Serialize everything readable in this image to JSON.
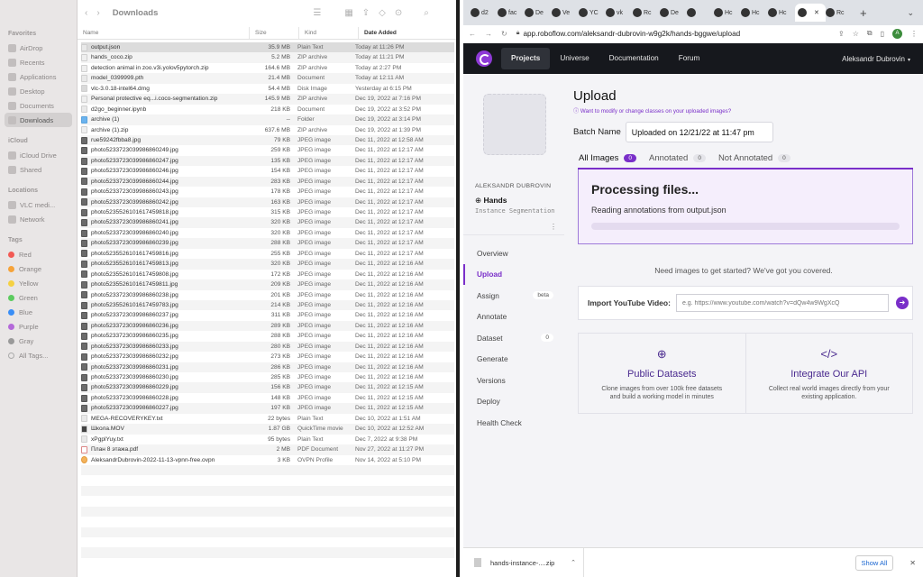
{
  "finder": {
    "title": "Downloads",
    "sidebar": {
      "favorites_header": "Favorites",
      "favorites": [
        "AirDrop",
        "Recents",
        "Applications",
        "Desktop",
        "Documents",
        "Downloads"
      ],
      "icloud_header": "iCloud",
      "icloud": [
        "iCloud Drive",
        "Shared"
      ],
      "locations_header": "Locations",
      "locations": [
        "VLC medi...",
        "Network"
      ],
      "tags_header": "Tags",
      "tags": [
        {
          "label": "Red",
          "color": "#f25a54"
        },
        {
          "label": "Orange",
          "color": "#f6a33a"
        },
        {
          "label": "Yellow",
          "color": "#f5d142"
        },
        {
          "label": "Green",
          "color": "#5ccb5f"
        },
        {
          "label": "Blue",
          "color": "#3a8ef6"
        },
        {
          "label": "Purple",
          "color": "#b469d9"
        },
        {
          "label": "Gray",
          "color": "#9a9a9a"
        },
        {
          "label": "All Tags...",
          "color": "#e9e6e6"
        }
      ]
    },
    "columns": {
      "name": "Name",
      "size": "Size",
      "kind": "Kind",
      "date": "Date Added"
    },
    "files": [
      {
        "name": "output.json",
        "size": "35.9 MB",
        "kind": "Plain Text",
        "date": "Today at 11:26 PM",
        "icon": "doc"
      },
      {
        "name": "hands_coco.zip",
        "size": "5.2 MB",
        "kind": "ZIP archive",
        "date": "Today at 11:21 PM",
        "icon": "zip"
      },
      {
        "name": "detection animal in zoo.v3i.yolov5pytorch.zip",
        "size": "164.6 MB",
        "kind": "ZIP archive",
        "date": "Today at 2:27 PM",
        "icon": "zip"
      },
      {
        "name": "model_0399999.pth",
        "size": "21.4 MB",
        "kind": "Document",
        "date": "Today at 12:11 AM",
        "icon": "doc"
      },
      {
        "name": "vlc-3.0.18-intel64.dmg",
        "size": "54.4 MB",
        "kind": "Disk Image",
        "date": "Yesterday at 6:15 PM",
        "icon": "dmg"
      },
      {
        "name": "Personal protective eq...i.coco-segmentation.zip",
        "size": "145.9 MB",
        "kind": "ZIP archive",
        "date": "Dec 19, 2022 at 7:16 PM",
        "icon": "zip"
      },
      {
        "name": "d2go_beginner.ipynb",
        "size": "218 KB",
        "kind": "Document",
        "date": "Dec 19, 2022 at 3:52 PM",
        "icon": "doc"
      },
      {
        "name": "archive (1)",
        "size": "--",
        "kind": "Folder",
        "date": "Dec 19, 2022 at 3:14 PM",
        "icon": "folder"
      },
      {
        "name": "archive (1).zip",
        "size": "637.6 MB",
        "kind": "ZIP archive",
        "date": "Dec 19, 2022 at 1:39 PM",
        "icon": "zip"
      },
      {
        "name": "rue59242fbba8.jpg",
        "size": "79 KB",
        "kind": "JPEG image",
        "date": "Dec 11, 2022 at 12:58 AM",
        "icon": "jpg"
      },
      {
        "name": "photo5233723039986860249.jpg",
        "size": "259 KB",
        "kind": "JPEG image",
        "date": "Dec 11, 2022 at 12:17 AM",
        "icon": "jpg"
      },
      {
        "name": "photo5233723039986860247.jpg",
        "size": "135 KB",
        "kind": "JPEG image",
        "date": "Dec 11, 2022 at 12:17 AM",
        "icon": "jpg"
      },
      {
        "name": "photo5233723039986860246.jpg",
        "size": "154 KB",
        "kind": "JPEG image",
        "date": "Dec 11, 2022 at 12:17 AM",
        "icon": "jpg"
      },
      {
        "name": "photo5233723039986860244.jpg",
        "size": "283 KB",
        "kind": "JPEG image",
        "date": "Dec 11, 2022 at 12:17 AM",
        "icon": "jpg"
      },
      {
        "name": "photo5233723039986860243.jpg",
        "size": "178 KB",
        "kind": "JPEG image",
        "date": "Dec 11, 2022 at 12:17 AM",
        "icon": "jpg"
      },
      {
        "name": "photo5233723039986860242.jpg",
        "size": "163 KB",
        "kind": "JPEG image",
        "date": "Dec 11, 2022 at 12:17 AM",
        "icon": "jpg"
      },
      {
        "name": "photo5235526101617459818.jpg",
        "size": "315 KB",
        "kind": "JPEG image",
        "date": "Dec 11, 2022 at 12:17 AM",
        "icon": "jpg"
      },
      {
        "name": "photo5233723039986860241.jpg",
        "size": "320 KB",
        "kind": "JPEG image",
        "date": "Dec 11, 2022 at 12:17 AM",
        "icon": "jpg"
      },
      {
        "name": "photo5233723039986860240.jpg",
        "size": "320 KB",
        "kind": "JPEG image",
        "date": "Dec 11, 2022 at 12:17 AM",
        "icon": "jpg"
      },
      {
        "name": "photo5233723039986860239.jpg",
        "size": "288 KB",
        "kind": "JPEG image",
        "date": "Dec 11, 2022 at 12:17 AM",
        "icon": "jpg"
      },
      {
        "name": "photo5235526101617459816.jpg",
        "size": "255 KB",
        "kind": "JPEG image",
        "date": "Dec 11, 2022 at 12:17 AM",
        "icon": "jpg"
      },
      {
        "name": "photo5235526101617459813.jpg",
        "size": "320 KB",
        "kind": "JPEG image",
        "date": "Dec 11, 2022 at 12:16 AM",
        "icon": "jpg"
      },
      {
        "name": "photo5235526101617459808.jpg",
        "size": "172 KB",
        "kind": "JPEG image",
        "date": "Dec 11, 2022 at 12:16 AM",
        "icon": "jpg"
      },
      {
        "name": "photo5235526101617459811.jpg",
        "size": "209 KB",
        "kind": "JPEG image",
        "date": "Dec 11, 2022 at 12:16 AM",
        "icon": "jpg"
      },
      {
        "name": "photo5233723039986860238.jpg",
        "size": "201 KB",
        "kind": "JPEG image",
        "date": "Dec 11, 2022 at 12:16 AM",
        "icon": "jpg"
      },
      {
        "name": "photo5235526101617459783.jpg",
        "size": "214 KB",
        "kind": "JPEG image",
        "date": "Dec 11, 2022 at 12:16 AM",
        "icon": "jpg"
      },
      {
        "name": "photo5233723039986860237.jpg",
        "size": "311 KB",
        "kind": "JPEG image",
        "date": "Dec 11, 2022 at 12:16 AM",
        "icon": "jpg"
      },
      {
        "name": "photo5233723039986860236.jpg",
        "size": "289 KB",
        "kind": "JPEG image",
        "date": "Dec 11, 2022 at 12:16 AM",
        "icon": "jpg"
      },
      {
        "name": "photo5233723039986860235.jpg",
        "size": "288 KB",
        "kind": "JPEG image",
        "date": "Dec 11, 2022 at 12:16 AM",
        "icon": "jpg"
      },
      {
        "name": "photo5233723039986860233.jpg",
        "size": "280 KB",
        "kind": "JPEG image",
        "date": "Dec 11, 2022 at 12:16 AM",
        "icon": "jpg"
      },
      {
        "name": "photo5233723039986860232.jpg",
        "size": "273 KB",
        "kind": "JPEG image",
        "date": "Dec 11, 2022 at 12:16 AM",
        "icon": "jpg"
      },
      {
        "name": "photo5233723039986860231.jpg",
        "size": "286 KB",
        "kind": "JPEG image",
        "date": "Dec 11, 2022 at 12:16 AM",
        "icon": "jpg"
      },
      {
        "name": "photo5233723039986860230.jpg",
        "size": "285 KB",
        "kind": "JPEG image",
        "date": "Dec 11, 2022 at 12:16 AM",
        "icon": "jpg"
      },
      {
        "name": "photo5233723039986860229.jpg",
        "size": "156 KB",
        "kind": "JPEG image",
        "date": "Dec 11, 2022 at 12:15 AM",
        "icon": "jpg"
      },
      {
        "name": "photo5233723039986860228.jpg",
        "size": "148 KB",
        "kind": "JPEG image",
        "date": "Dec 11, 2022 at 12:15 AM",
        "icon": "jpg"
      },
      {
        "name": "photo5233723039986860227.jpg",
        "size": "197 KB",
        "kind": "JPEG image",
        "date": "Dec 11, 2022 at 12:15 AM",
        "icon": "jpg"
      },
      {
        "name": "MEGA-RECOVERYKEY.txt",
        "size": "22 bytes",
        "kind": "Plain Text",
        "date": "Dec 10, 2022 at 1:51 AM",
        "icon": "doc"
      },
      {
        "name": "Школа.MOV",
        "size": "1.87 GB",
        "kind": "QuickTime movie",
        "date": "Dec 10, 2022 at 12:52 AM",
        "icon": "mov"
      },
      {
        "name": "xPgplYuy.txt",
        "size": "95 bytes",
        "kind": "Plain Text",
        "date": "Dec 7, 2022 at 9:38 PM",
        "icon": "doc"
      },
      {
        "name": "План 8 этажа.pdf",
        "size": "2 MB",
        "kind": "PDF Document",
        "date": "Nov 27, 2022 at 11:27 PM",
        "icon": "pdf"
      },
      {
        "name": "AleksandrDubrovin-2022-11-13-vpnn-free.ovpn",
        "size": "3 KB",
        "kind": "OVPN Profile",
        "date": "Nov 14, 2022 at 5:10 PM",
        "icon": "ovpn"
      }
    ]
  },
  "browser": {
    "tabs": [
      "d2",
      "fac",
      "De",
      "Ve",
      "YC",
      "vk",
      "Rc",
      "De",
      "",
      "Hc",
      "Hc",
      "Hc",
      "",
      "Rc"
    ],
    "url": "app.roboflow.com/aleksandr-dubrovin-w9g2k/hands-bggwe/upload",
    "avatar_letter": "A",
    "nav": {
      "items": [
        "Projects",
        "Universe",
        "Documentation",
        "Forum"
      ],
      "user": "Aleksandr Dubrovin"
    },
    "project": {
      "owner": "ALEKSANDR DUBROVIN",
      "name": "Hands",
      "type": "Instance Segmentation",
      "menu": [
        {
          "label": "Overview",
          "badge": ""
        },
        {
          "label": "Upload",
          "badge": ""
        },
        {
          "label": "Assign",
          "badge": "beta"
        },
        {
          "label": "Annotate",
          "badge": ""
        },
        {
          "label": "Dataset",
          "badge": "0"
        },
        {
          "label": "Generate",
          "badge": ""
        },
        {
          "label": "Versions",
          "badge": ""
        },
        {
          "label": "Deploy",
          "badge": ""
        },
        {
          "label": "Health Check",
          "badge": ""
        }
      ]
    },
    "upload": {
      "title": "Upload",
      "help_link": "Want to modify or change classes on your uploaded images?",
      "batch_label": "Batch Name",
      "batch_value": "Uploaded on 12/21/22 at 11:47 pm",
      "tabs": [
        {
          "label": "All Images",
          "count": "0"
        },
        {
          "label": "Annotated",
          "count": "0"
        },
        {
          "label": "Not Annotated",
          "count": "0"
        }
      ],
      "processing_title": "Processing files...",
      "processing_sub": "Reading annotations from output.json",
      "need_images": "Need images to get started? We've got you covered.",
      "youtube_label": "Import YouTube Video:",
      "youtube_placeholder": "e.g. https://www.youtube.com/watch?v=dQw4w9WgXcQ",
      "cards": [
        {
          "title": "Public Datasets",
          "desc": "Clone images from over 100k free datasets and build a working model in minutes",
          "icon": "globe-icon"
        },
        {
          "title": "Integrate Our API",
          "desc": "Collect real world images directly from your existing application.",
          "icon": "code-icon"
        }
      ]
    },
    "download": {
      "file": "hands-instance-....zip",
      "show_all": "Show All"
    }
  }
}
